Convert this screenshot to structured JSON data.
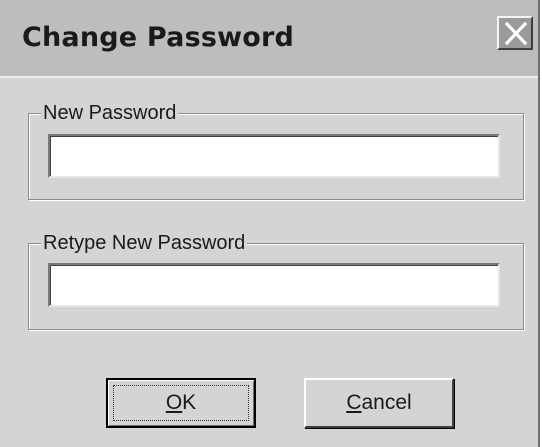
{
  "dialog": {
    "title": "Change Password",
    "close_icon": "close-x-icon"
  },
  "new_password": {
    "label": "New Password",
    "value": ""
  },
  "retype_password": {
    "label": "Retype New Password",
    "value": ""
  },
  "buttons": {
    "ok": {
      "mnemonic": "O",
      "rest": "K"
    },
    "cancel": {
      "mnemonic": "C",
      "rest": "ancel"
    }
  },
  "colors": {
    "dialog_bg": "#d4d4d4",
    "titlebar_bg": "#bdbdbd",
    "close_bg": "#9a9a9a"
  }
}
